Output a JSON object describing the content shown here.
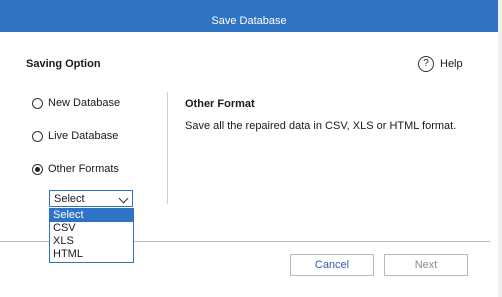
{
  "window": {
    "title": "Save Database"
  },
  "panel": {
    "label": "Saving Option"
  },
  "help": {
    "label": "Help"
  },
  "options": [
    {
      "label": "New Database",
      "checked": false
    },
    {
      "label": "Live Database",
      "checked": false
    },
    {
      "label": "Other Formats",
      "checked": true
    }
  ],
  "description": {
    "title": "Other Format",
    "text": "Save all the repaired data in CSV, XLS or HTML format."
  },
  "format_select": {
    "value": "Select",
    "options": [
      "Select",
      "CSV",
      "XLS",
      "HTML"
    ],
    "highlighted_index": 0
  },
  "buttons": {
    "cancel": "Cancel",
    "next": "Next"
  },
  "colors": {
    "accent": "#2f73c4",
    "separator": "#cfcfcf"
  }
}
